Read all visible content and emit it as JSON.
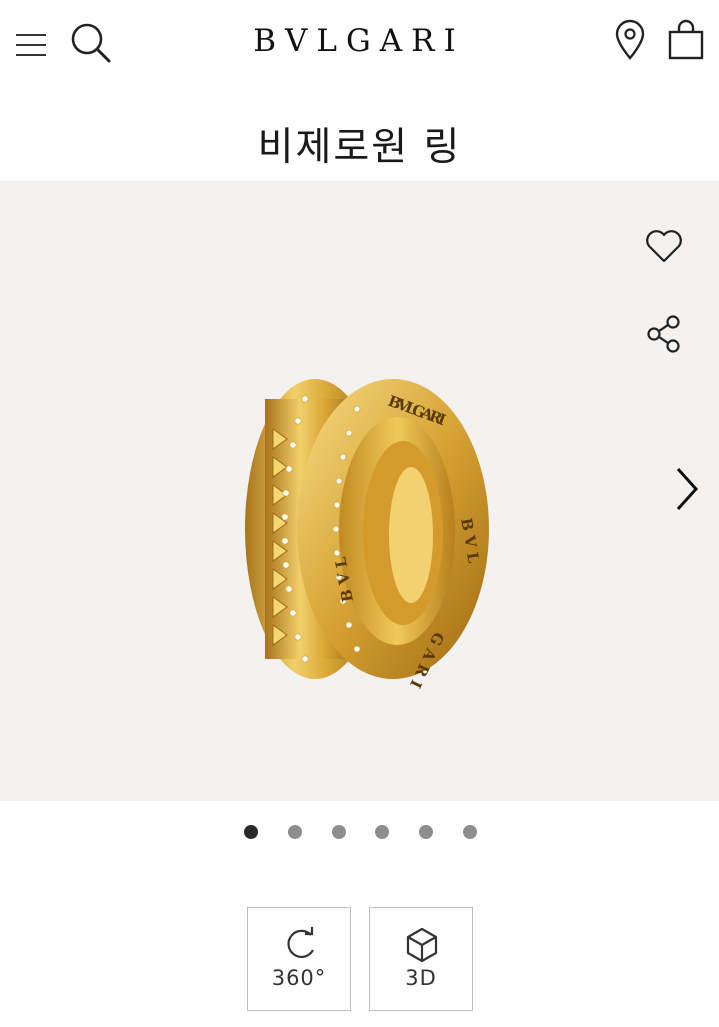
{
  "header": {
    "logo": "BVLGARI",
    "icons": [
      "menu-icon",
      "search-icon",
      "location-pin-icon",
      "shopping-bag-icon"
    ]
  },
  "product": {
    "title": "비제로원 링"
  },
  "gallery": {
    "background": "#f3f2f0",
    "image_subject": "ring",
    "icons": [
      "heart-icon",
      "share-icon",
      "chevron-right-icon"
    ],
    "ring_engraving": "BVLGARI"
  },
  "pagination": {
    "total": 6,
    "active_index": 0
  },
  "view_buttons": {
    "rotate_label": "360°",
    "three_d_label": "3D"
  },
  "colors": {
    "text": "#1a1a1a",
    "gallery_bg": "#f3f2f0",
    "gold": "#d4a52c",
    "dot_inactive": "#8e8e8e",
    "dot_active": "#2a2a2a"
  }
}
